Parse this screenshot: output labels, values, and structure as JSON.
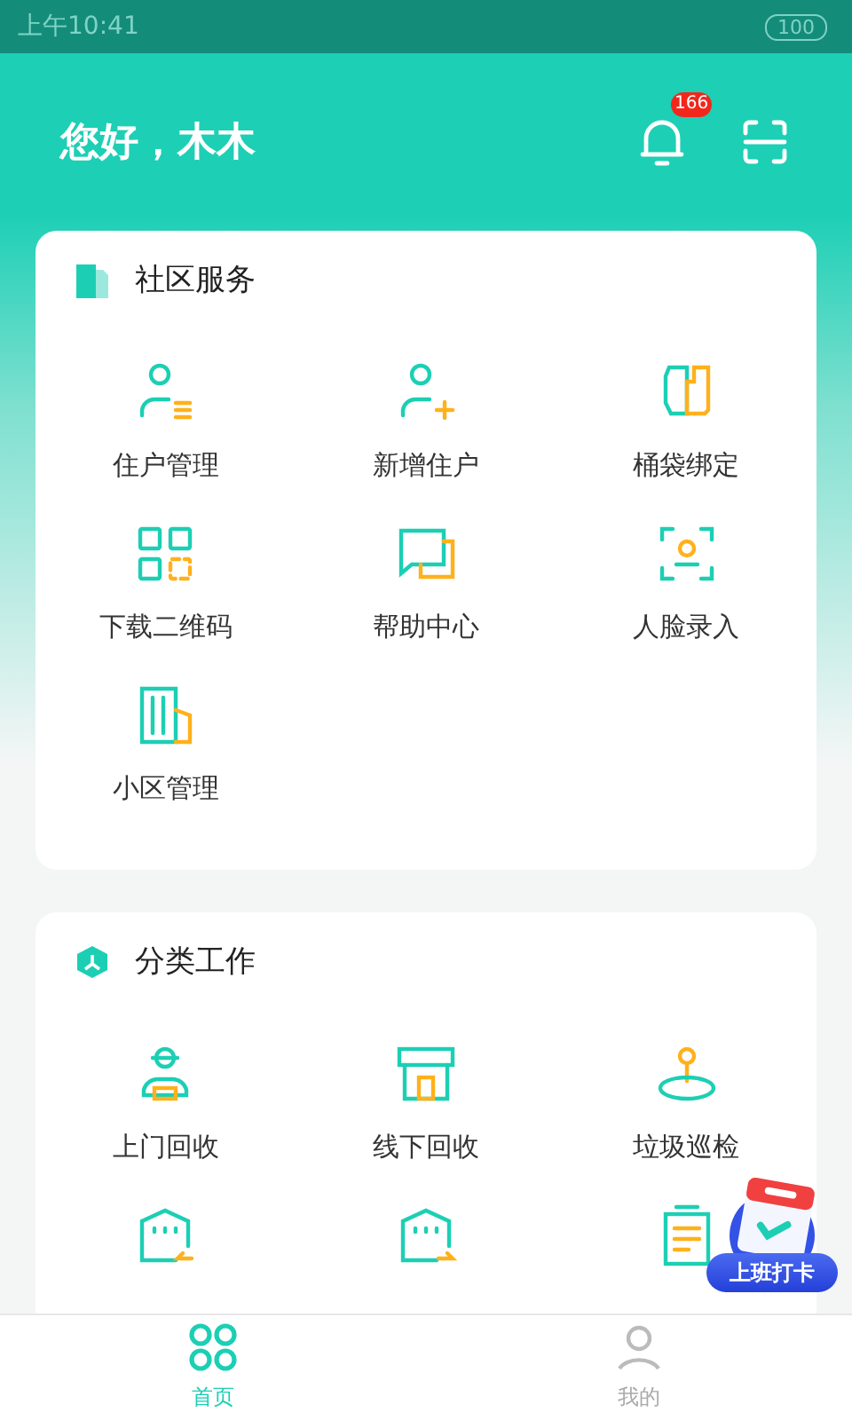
{
  "status_bar": {
    "time": "上午10:41",
    "battery": "100"
  },
  "header": {
    "greeting": "您好，木木",
    "notification_count": "166"
  },
  "sections": [
    {
      "title": "社区服务",
      "items": [
        {
          "label": "住户管理"
        },
        {
          "label": "新增住户"
        },
        {
          "label": "桶袋绑定"
        },
        {
          "label": "下载二维码"
        },
        {
          "label": "帮助中心"
        },
        {
          "label": "人脸录入"
        },
        {
          "label": "小区管理"
        }
      ]
    },
    {
      "title": "分类工作",
      "items": [
        {
          "label": "上门回收"
        },
        {
          "label": "线下回收"
        },
        {
          "label": "垃圾巡检"
        }
      ]
    }
  ],
  "floating_button": {
    "label": "上班打卡"
  },
  "tab_bar": [
    {
      "label": "首页",
      "selected": true
    },
    {
      "label": "我的",
      "selected": false
    }
  ]
}
